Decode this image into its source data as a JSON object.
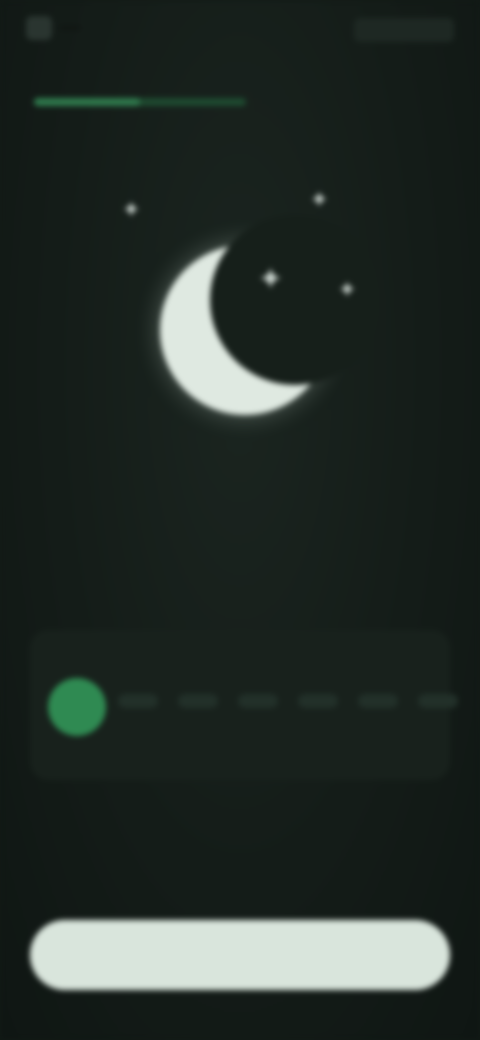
{
  "status_bar": {
    "time": "",
    "status_icons": ""
  },
  "progress": {
    "fraction": 0.5
  },
  "illustration": {
    "icons": [
      "moon-icon",
      "sparkle-icon"
    ],
    "colors": {
      "moon": "#dfe9e1",
      "accent": "#2f8a52",
      "background": "#121a16"
    }
  },
  "headline": {
    "text": ""
  },
  "week": {
    "days": [
      "",
      "",
      "",
      "",
      "",
      ""
    ],
    "caption": ""
  },
  "cta": {
    "label": ""
  }
}
